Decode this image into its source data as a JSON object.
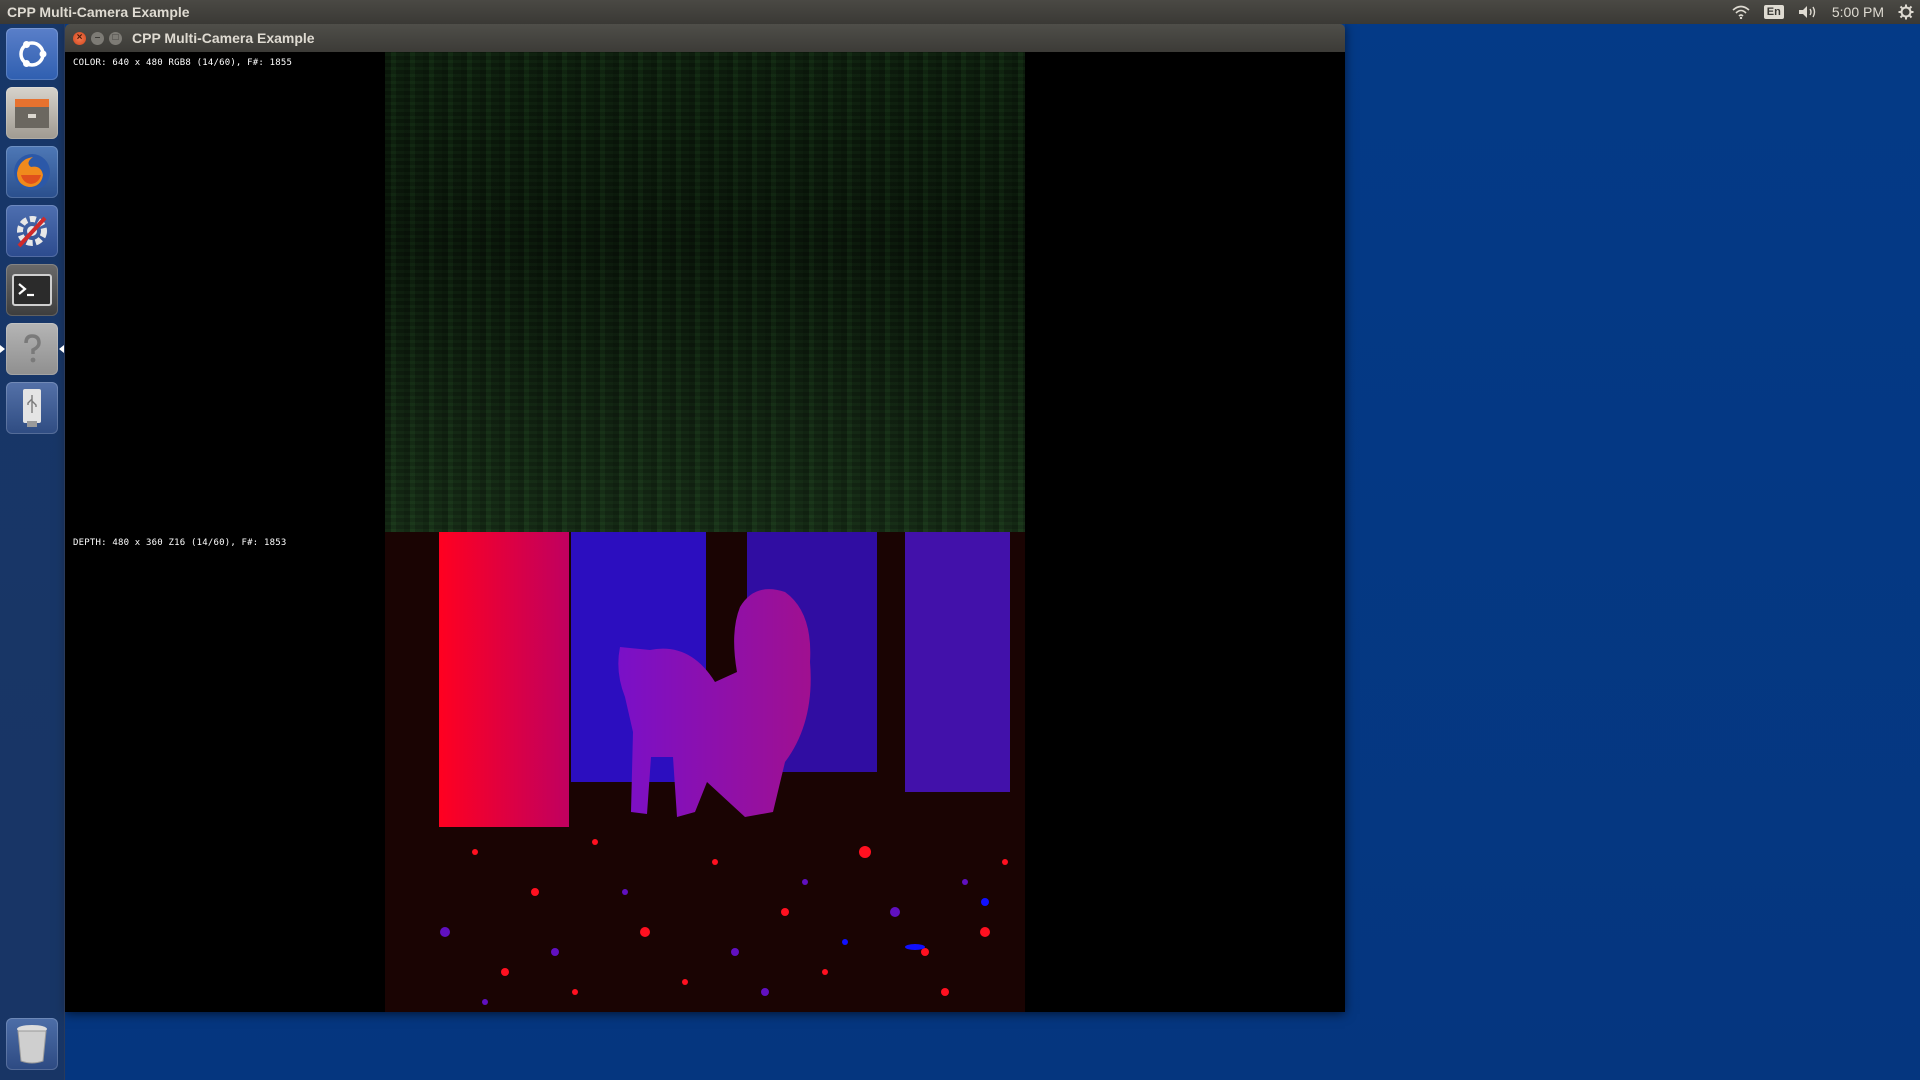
{
  "top_panel": {
    "app_title": "CPP Multi-Camera Example",
    "language": "En",
    "clock": "5:00 PM"
  },
  "launcher": {
    "items": [
      "ubuntu-home",
      "files",
      "firefox",
      "system-settings",
      "terminal",
      "help",
      "usb-drive",
      "trash"
    ]
  },
  "window": {
    "title": "CPP Multi-Camera Example",
    "overlays": {
      "color": "COLOR: 640 x 480 RGB8 (14/60), F#: 1855",
      "depth": "DEPTH: 480 x 360 Z16 (14/60), F#: 1853"
    }
  },
  "colors": {
    "desktop": "#05357f",
    "panel": "#3c3b37",
    "close_button": "#e5582a"
  }
}
